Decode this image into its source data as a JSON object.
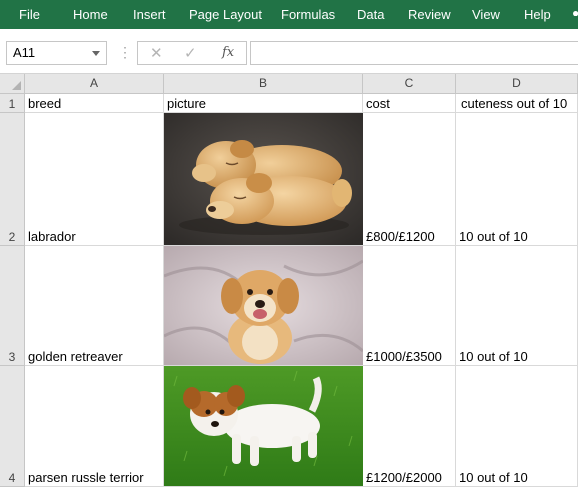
{
  "ribbon": {
    "menu": [
      "File",
      "Home",
      "Insert",
      "Page Layout",
      "Formulas",
      "Data",
      "Review",
      "View",
      "Help"
    ],
    "color": "#217346"
  },
  "formula_bar": {
    "name_box": "A11",
    "fx_label": "fx",
    "formula": ""
  },
  "columns": [
    "A",
    "B",
    "C",
    "D"
  ],
  "rows": [
    {
      "number": "1",
      "breed": "breed",
      "picture": "picture",
      "cost": "cost",
      "cuteness": "cuteness out of 10"
    },
    {
      "number": "2",
      "breed": "labrador",
      "picture": "",
      "cost": "£800/£1200",
      "cuteness": "10 out of 10"
    },
    {
      "number": "3",
      "breed": "golden retreaver",
      "picture": "",
      "cost": "£1000/£3500",
      "cuteness": "10 out of 10"
    },
    {
      "number": "4",
      "breed": "parsen russle terrior",
      "picture": "",
      "cost": "£1200/£2000",
      "cuteness": "10 out of 10"
    }
  ]
}
